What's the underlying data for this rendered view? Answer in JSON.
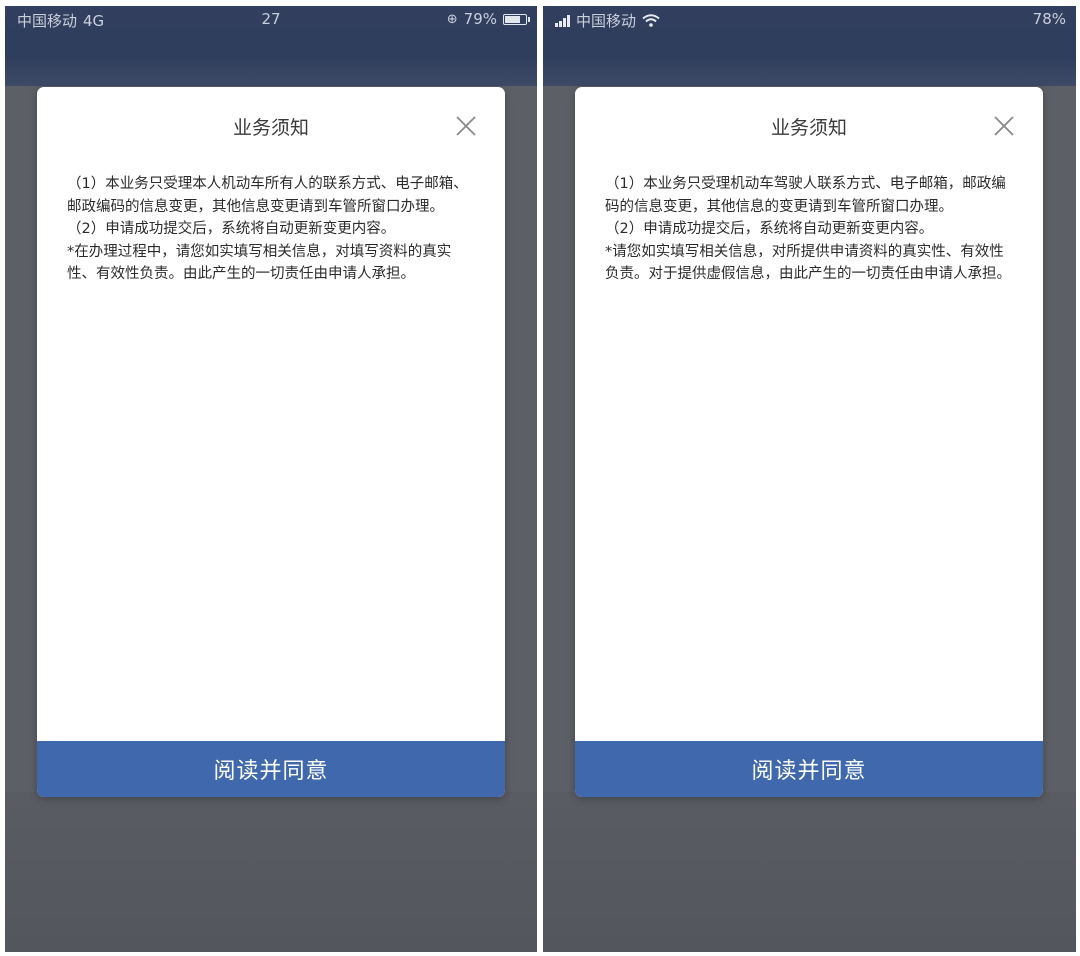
{
  "left": {
    "status": {
      "carrier": "中国移动",
      "network": "4G",
      "time": "27",
      "battery": "79%",
      "battery_level": 0.79
    },
    "dialog": {
      "title": "业务须知",
      "paragraphs": [
        "（1）本业务只受理本人机动车所有人的联系方式、电子邮箱、邮政编码的信息变更，其他信息变更请到车管所窗口办理。",
        "（2）申请成功提交后，系统将自动更新变更内容。",
        "*在办理过程中，请您如实填写相关信息，对填写资料的真实性、有效性负责。由此产生的一切责任由申请人承担。"
      ],
      "agree_label": "阅读并同意"
    }
  },
  "right": {
    "status": {
      "carrier": "中国移动",
      "battery": "78%",
      "battery_level": 0.78
    },
    "dialog": {
      "title": "业务须知",
      "paragraphs": [
        "（1）本业务只受理机动车驾驶人联系方式、电子邮箱，邮政编码的信息变更，其他信息的变更请到车管所窗口办理。",
        "（2）申请成功提交后，系统将自动更新变更内容。",
        "*请您如实填写相关信息，对所提供申请资料的真实性、有效性负责。对于提供虚假信息，由此产生的一切责任由申请人承担。"
      ],
      "agree_label": "阅读并同意"
    }
  },
  "icons": {
    "close": "close-icon",
    "signal": "signal-icon",
    "wifi": "wifi-icon",
    "battery": "battery-icon",
    "lock": "orientation-lock-icon"
  },
  "colors": {
    "accent": "#4069ad",
    "overlay": "#5d5f66",
    "status_bar": "#323f5f"
  }
}
